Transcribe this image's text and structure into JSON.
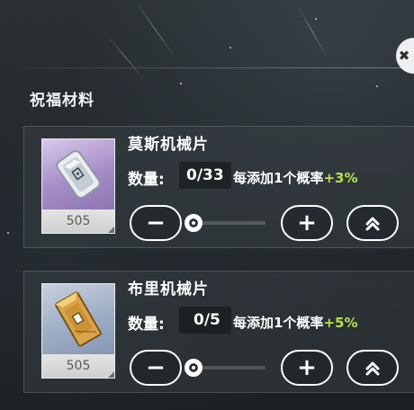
{
  "header": {
    "corner_button_glyph": "✖"
  },
  "section": {
    "title": "祝福材料"
  },
  "materials": [
    {
      "name": "莫斯机械片",
      "owned_count": "505",
      "quantity_label": "数量:",
      "quantity_value": "0/33",
      "chance_text": "每添加1个概率",
      "chance_bonus": "+3%",
      "slider_fraction": 0,
      "art_color": "#a58cc6",
      "icon": "silver-chip-icon"
    },
    {
      "name": "布里机械片",
      "owned_count": "505",
      "quantity_label": "数量:",
      "quantity_value": "0/5",
      "chance_text": "每添加1个概率",
      "chance_bonus": "+5%",
      "slider_fraction": 0,
      "art_color": "#9eadc4",
      "icon": "gold-chip-icon"
    }
  ],
  "buttons": {
    "minus_glyph": "−",
    "plus_glyph": "+"
  },
  "colors": {
    "bonus_green": "#b7e34b",
    "panel_border": "#ffffff"
  }
}
